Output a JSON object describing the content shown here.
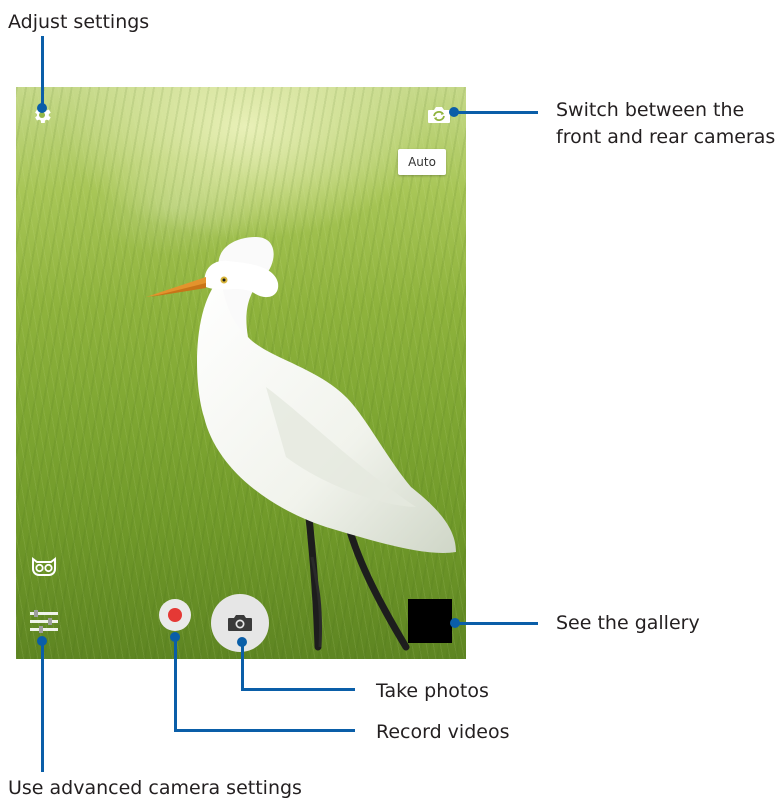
{
  "callouts": {
    "adjust_settings": "Adjust settings",
    "switch_cameras_line1": "Switch between the",
    "switch_cameras_line2": "front and rear cameras",
    "see_gallery": "See the gallery",
    "take_photos": "Take photos",
    "record_videos": "Record videos",
    "advanced_settings": "Use advanced camera settings"
  },
  "viewfinder": {
    "mode_button": "Auto"
  },
  "icons": {
    "settings": "gear-icon",
    "switch_camera": "camera-switch-icon",
    "owl": "owl-icon",
    "advanced": "advanced-settings-icon",
    "record": "record-icon",
    "shutter": "camera-icon"
  },
  "colors": {
    "callout_line": "#0a5ea8",
    "record_red": "#e53935"
  }
}
